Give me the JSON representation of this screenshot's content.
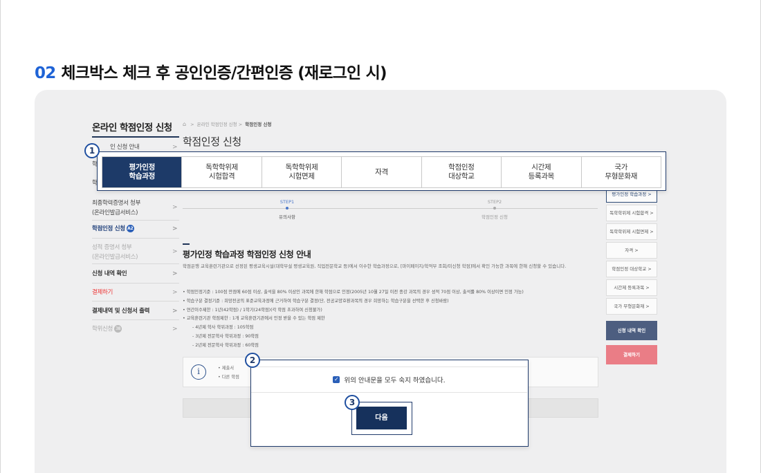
{
  "heading": {
    "number": "02",
    "text": "체크박스 체크 후 공인인증/간편인증 (재로그인 시)"
  },
  "sidebar": {
    "title": "온라인 학점인정 신청",
    "items": [
      {
        "label": "인 신청 안내"
      },
      {
        "label": "학"
      },
      {
        "label": "학"
      },
      {
        "label": "최종학력증명서 청부",
        "label2": "(온라인발급서비스)"
      },
      {
        "label": "학점인정 신청",
        "badge": "A2"
      },
      {
        "label": "성적 증명서 청부",
        "label2": "(온라인발급서비스)"
      },
      {
        "label": "신청 내역 확인"
      },
      {
        "label": "결제하기"
      },
      {
        "label": "결제내역 및 신청서 출력"
      },
      {
        "label": "학위신청",
        "badge": "38"
      }
    ]
  },
  "breadcrumb": {
    "items": [
      "온라인 학점인정 신청",
      "학점인정 신청"
    ]
  },
  "page_title": "학점인정 신청",
  "tabs": [
    {
      "line1": "평가인정",
      "line2": "학습과정"
    },
    {
      "line1": "독학학위제",
      "line2": "시험합격"
    },
    {
      "line1": "독학학위제",
      "line2": "시험면제"
    },
    {
      "line1": "자격",
      "line2": ""
    },
    {
      "line1": "학점인정",
      "line2": "대상학교"
    },
    {
      "line1": "시간제",
      "line2": "등록과목"
    },
    {
      "line1": "국가",
      "line2": "무형문화재"
    }
  ],
  "steps": [
    {
      "code": "STEP1",
      "label": "유의사항"
    },
    {
      "code": "STEP2",
      "label": "학점인정 신청"
    }
  ],
  "section": {
    "title": "평가인정 학습과정 학점인정 신청 안내",
    "paragraph": "학점은행 교육훈련기관으로 선정된 평생교육시설(대학부설 평생교육원, 직업전문학교 등)에서 이수한 학습과정으로, [마이페이지/학적부 조회/미신청 학점]에서 확인 가능한 과목에 한해 신청할 수 있습니다.",
    "bullets": [
      "• 학점인정기준 : 100점 만점에 60점 이상, 출석을 80% 이상인 과목에 한해 학점으로 인정(2005년 10월 27일 이전 종강 과목의 경우 성적 70점 이상, 출석률 80% 이상이면 인정 가능)",
      "• 학습구분 결정기준 : 희망전공의 표준교육과정에 근거하여 학습구분 결정(단, 전공교양호환과목의 경우 희망하는 학습구분을 선택한 후 신청바람)",
      "• 연간이수제한 : 1년(42학점) / 1학기(24학점)(각 학점 초과하여 신청불가)",
      "• 교육훈련기관 학점제한 : 1개 교육훈련기관에서 인정 받을 수 있는 학점 제한"
    ],
    "sub_bullets": [
      "- 4년제 학사 학위과정 : 105학점",
      "- 3년제 전문학사 학위과정 : 90학점",
      "- 2년제 전문학사 학위과정 : 60학점"
    ]
  },
  "info_box": {
    "lines": [
      "• 제출서",
      "• 다른 학점"
    ]
  },
  "right_buttons": [
    "평가인정 학습과정 >",
    "독학학위제 시험합격 >",
    "독학학위제 시험면제 >",
    "자격 >",
    "학점인정 대상학교 >",
    "시간제 등록과목 >",
    "국가 무형문화재 >"
  ],
  "action_buttons": {
    "confirm": "신청 내역 확인",
    "pay": "결제하기"
  },
  "dialog": {
    "checkbox_label": "위의 안내문을 모두 숙지 하였습니다.",
    "next_label": "다음"
  },
  "markers": [
    "1",
    "2",
    "3"
  ],
  "colors": {
    "accent": "#1e63d6",
    "navy": "#1d3a68",
    "pink": "#ea7d86"
  }
}
